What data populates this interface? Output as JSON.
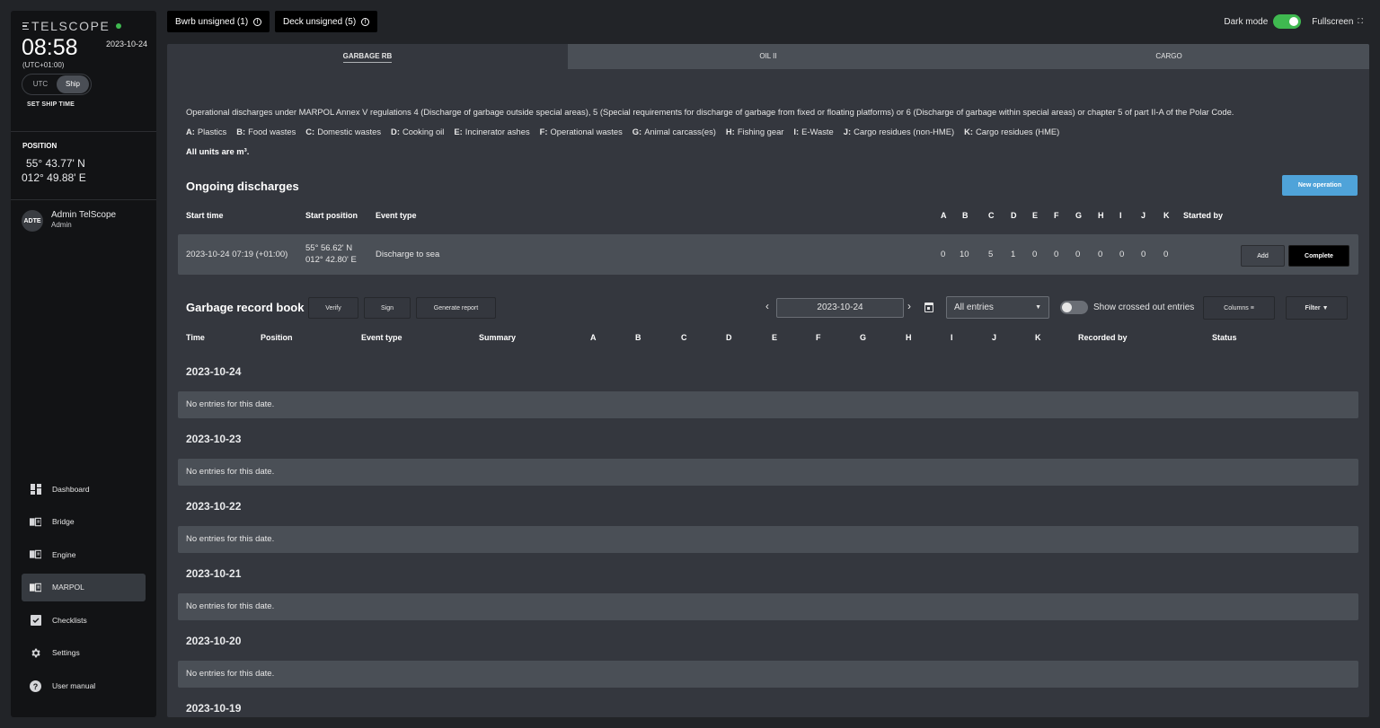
{
  "sidebar": {
    "brand": "TELSCOPE",
    "time": "08:58",
    "date": "2023-10-24",
    "timezone": "(UTC+01:00)",
    "tz_options": [
      "UTC",
      "Ship"
    ],
    "tz_selected": "Ship",
    "set_time_label": "SET SHIP TIME",
    "position_label": "POSITION",
    "position_lat": "55° 43.77' N",
    "position_lon": "012° 49.88' E",
    "user": {
      "initials": "ADTE",
      "name": "Admin TelScope",
      "role": "Admin"
    },
    "nav": [
      {
        "label": "Dashboard",
        "icon": "dashboard-icon"
      },
      {
        "label": "Bridge",
        "icon": "book-icon"
      },
      {
        "label": "Engine",
        "icon": "book-icon"
      },
      {
        "label": "MARPOL",
        "icon": "book-icon",
        "active": true
      },
      {
        "label": "Checklists",
        "icon": "checkbox-icon"
      },
      {
        "label": "Settings",
        "icon": "gear-icon"
      },
      {
        "label": "User manual",
        "icon": "help-icon"
      }
    ]
  },
  "topbar": {
    "pills": [
      "Bwrb unsigned (1)",
      "Deck unsigned (5)"
    ],
    "dark_mode_label": "Dark mode",
    "dark_mode_on": true,
    "fullscreen_label": "Fullscreen"
  },
  "tabs": [
    {
      "label": "GARBAGE RB",
      "active": true
    },
    {
      "label": "OIL II"
    },
    {
      "label": "CARGO"
    }
  ],
  "intro": {
    "description": "Operational discharges under MARPOL Annex V regulations 4 (Discharge of garbage outside special areas), 5 (Special requirements for discharge of garbage from fixed or floating platforms) or 6 (Discharge of garbage within special areas) or chapter 5 of part II-A of the Polar Code.",
    "legend": [
      {
        "key": "A:",
        "label": "Plastics"
      },
      {
        "key": "B:",
        "label": "Food wastes"
      },
      {
        "key": "C:",
        "label": "Domestic wastes"
      },
      {
        "key": "D:",
        "label": "Cooking oil"
      },
      {
        "key": "E:",
        "label": "Incinerator ashes"
      },
      {
        "key": "F:",
        "label": "Operational wastes"
      },
      {
        "key": "G:",
        "label": "Animal carcass(es)"
      },
      {
        "key": "H:",
        "label": "Fishing gear"
      },
      {
        "key": "I:",
        "label": "E-Waste"
      },
      {
        "key": "J:",
        "label": "Cargo residues (non-HME)"
      },
      {
        "key": "K:",
        "label": "Cargo residues (HME)"
      }
    ],
    "units": "All units are m³."
  },
  "ongoing": {
    "title": "Ongoing discharges",
    "new_button": "New operation",
    "headers": {
      "start_time": "Start time",
      "start_position": "Start position",
      "event_type": "Event type",
      "letters": [
        "A",
        "B",
        "C",
        "D",
        "E",
        "F",
        "G",
        "H",
        "I",
        "J",
        "K"
      ],
      "started_by": "Started by"
    },
    "rows": [
      {
        "start_time": "2023-10-24 07:19 (+01:00)",
        "lat": "55° 56.62' N",
        "lon": "012° 42.80' E",
        "event_type": "Discharge to sea",
        "values": [
          "0",
          "10",
          "5",
          "1",
          "0",
          "0",
          "0",
          "0",
          "0",
          "0",
          "0"
        ],
        "started_by": "",
        "add_label": "Add",
        "complete_label": "Complete"
      }
    ]
  },
  "record_book": {
    "title": "Garbage record book",
    "verify_label": "Verify",
    "sign_label": "Sign",
    "report_label": "Generate report",
    "date_value": "2023-10-24",
    "prev_label": "‹",
    "next_label": "›",
    "filter_select": "All entries",
    "show_crossed_label": "Show crossed out entries",
    "show_crossed_on": false,
    "columns_label": "Columns",
    "filter_label": "Filter",
    "headers": {
      "time": "Time",
      "position": "Position",
      "event_type": "Event type",
      "summary": "Summary",
      "letters": [
        "A",
        "B",
        "C",
        "D",
        "E",
        "F",
        "G",
        "H",
        "I",
        "J",
        "K"
      ],
      "recorded_by": "Recorded by",
      "status": "Status"
    },
    "days": [
      {
        "date": "2023-10-24",
        "message": "No entries for this date."
      },
      {
        "date": "2023-10-23",
        "message": "No entries for this date."
      },
      {
        "date": "2023-10-22",
        "message": "No entries for this date."
      },
      {
        "date": "2023-10-21",
        "message": "No entries for this date."
      },
      {
        "date": "2023-10-20",
        "message": "No entries for this date."
      },
      {
        "date": "2023-10-19",
        "message": ""
      }
    ]
  }
}
